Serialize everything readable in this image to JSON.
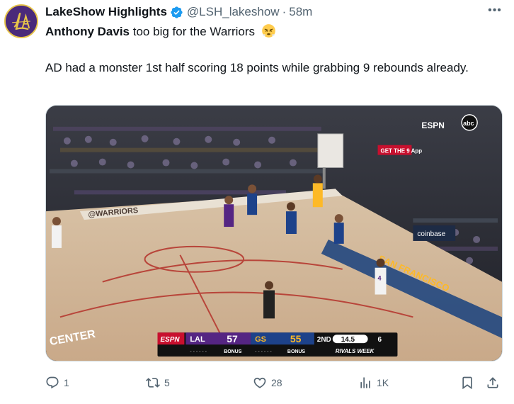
{
  "author": {
    "display_name": "LakeShow Highlights",
    "handle": "@LSH_lakeshow",
    "separator": "·",
    "time": "58m",
    "avatar_monogram": "LA",
    "verified_color": "#1d9bf0"
  },
  "tweet": {
    "headline_bold": "Anthony Davis",
    "headline_rest": " too big for the Warriors",
    "headline_emoji": "steaming-face-emoji",
    "body": "AD had a monster 1st half scoring 18 points while grabbing 9 rebounds already."
  },
  "media": {
    "description_icon": "basketball-game-broadcast",
    "court_text": "@WARRIORS",
    "baseline_text": "CENTER",
    "sponsor_text": "coinbase",
    "gym_text": "SAN FRANCISCO",
    "ad_text": "GET THE 9 App",
    "jersey_number_near": "4",
    "network_logo": "ESPN",
    "abc_logo": "abc",
    "scoreboard": {
      "network": "ESPN",
      "away_team": "LAL",
      "away_score": "57",
      "away_status": "BONUS",
      "home_team": "GS",
      "home_score": "55",
      "home_status": "BONUS",
      "period": "2ND",
      "shot_clock": "14.5",
      "game_clock": "6",
      "event": "RIVALS WEEK",
      "away_color": "#552583",
      "home_color": "#1d428a",
      "accent_color": "#fdb927"
    }
  },
  "actions": {
    "replies": "1",
    "reposts": "5",
    "likes": "28",
    "views": "1K"
  },
  "colors": {
    "text_primary": "#0f1419",
    "text_secondary": "#536471",
    "border": "#cfd9de",
    "lakers_purple": "#4a2a7a",
    "lakers_gold": "#e7c44a"
  }
}
